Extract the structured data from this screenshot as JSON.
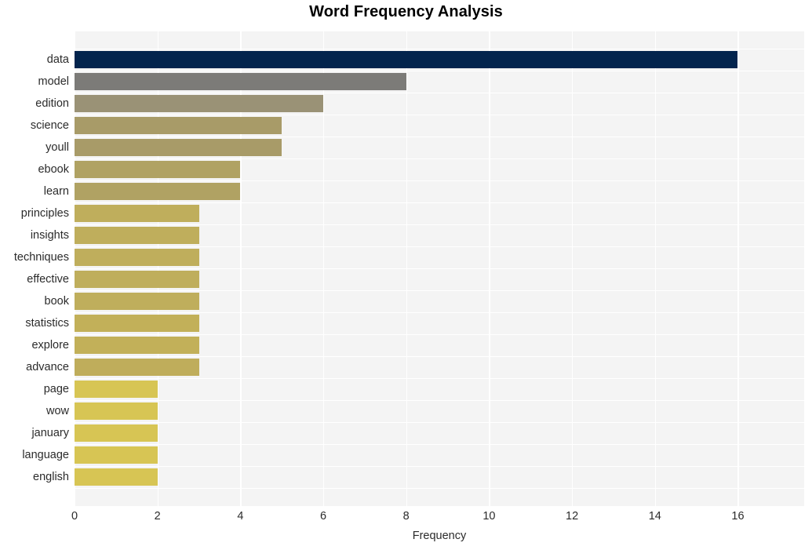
{
  "chart_data": {
    "type": "bar",
    "orientation": "horizontal",
    "title": "Word Frequency Analysis",
    "xlabel": "Frequency",
    "ylabel": "",
    "xlim": [
      0,
      17.6
    ],
    "xticks": [
      0,
      2,
      4,
      6,
      8,
      10,
      12,
      14,
      16
    ],
    "grid": true,
    "legend": null,
    "categories": [
      "data",
      "model",
      "edition",
      "science",
      "youll",
      "ebook",
      "learn",
      "principles",
      "insights",
      "techniques",
      "effective",
      "book",
      "statistics",
      "explore",
      "advance",
      "page",
      "wow",
      "january",
      "language",
      "english"
    ],
    "values": [
      16,
      8,
      6,
      5,
      5,
      4,
      4,
      3,
      3,
      3,
      3,
      3,
      3,
      3,
      3,
      2,
      2,
      2,
      2,
      2
    ],
    "bar_colors": [
      "#03244d",
      "#7c7b78",
      "#9a9276",
      "#a89b68",
      "#a89b68",
      "#b0a263",
      "#b0a263",
      "#bfae5c",
      "#bfae5c",
      "#bfae5c",
      "#bfae5c",
      "#bfae5c",
      "#c2b059",
      "#c2b059",
      "#bfad5b",
      "#d7c554",
      "#d7c554",
      "#d7c554",
      "#d7c554",
      "#d7c554"
    ]
  },
  "style": {
    "figure_background": "#ffffff",
    "plot_background": "#f4f4f4",
    "grid_color": "#ffffff",
    "text_color": "#2b2b2b",
    "title_color": "#000000"
  }
}
